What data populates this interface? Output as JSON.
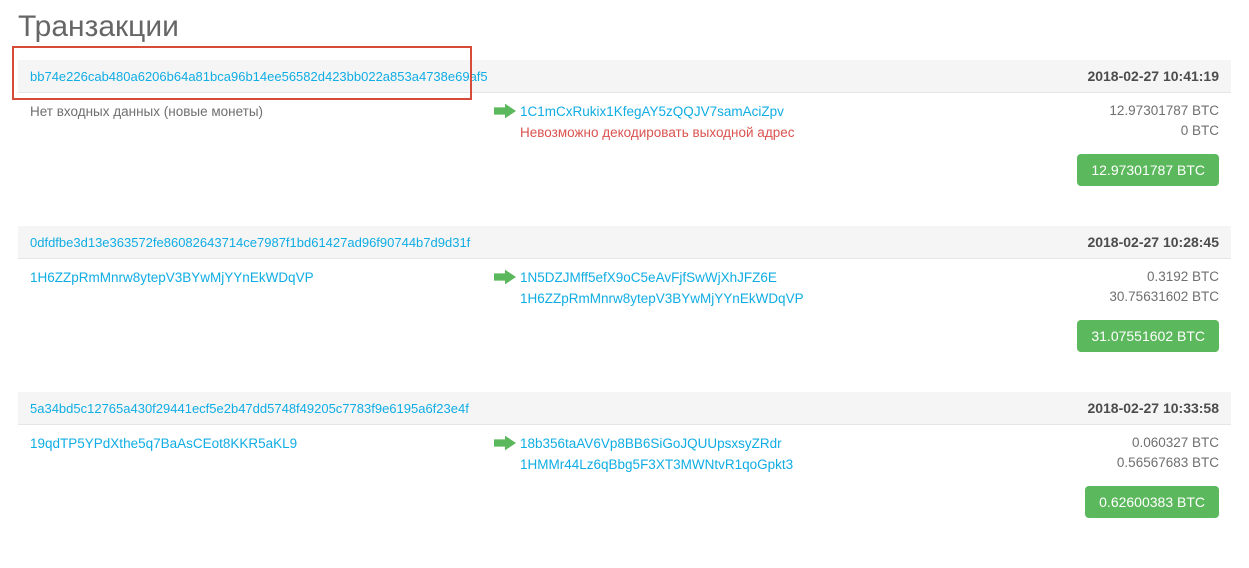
{
  "page_title": "Транзакции",
  "transactions": [
    {
      "hash": "bb74e226cab480a6206b64a81bca96b14ee56582d423bb022a853a4738e69af5",
      "timestamp": "2018-02-27 10:41:19",
      "highlighted": true,
      "inputs": [
        {
          "text": "Нет входных данных (новые монеты)",
          "type": "static"
        }
      ],
      "outputs": [
        {
          "addr": "1C1mCxRukix1KfegAY5zQQJV7samAciZpv",
          "type": "link",
          "amount": "12.97301787 BTC"
        },
        {
          "addr": "Невозможно декодировать выходной адрес",
          "type": "error",
          "amount": "0 BTC"
        }
      ],
      "total": "12.97301787 BTC"
    },
    {
      "hash": "0dfdfbe3d13e363572fe86082643714ce7987f1bd61427ad96f90744b7d9d31f",
      "timestamp": "2018-02-27 10:28:45",
      "inputs": [
        {
          "text": "1H6ZZpRmMnrw8ytepV3BYwMjYYnEkWDqVP",
          "type": "link"
        }
      ],
      "outputs": [
        {
          "addr": "1N5DZJMff5efX9oC5eAvFjfSwWjXhJFZ6E",
          "type": "link",
          "amount": "0.3192 BTC"
        },
        {
          "addr": "1H6ZZpRmMnrw8ytepV3BYwMjYYnEkWDqVP",
          "type": "link",
          "amount": "30.75631602 BTC"
        }
      ],
      "total": "31.07551602 BTC"
    },
    {
      "hash": "5a34bd5c12765a430f29441ecf5e2b47dd5748f49205c7783f9e6195a6f23e4f",
      "timestamp": "2018-02-27 10:33:58",
      "inputs": [
        {
          "text": "19qdTP5YPdXthe5q7BaAsCEot8KKR5aKL9",
          "type": "link"
        }
      ],
      "outputs": [
        {
          "addr": "18b356taAV6Vp8BB6SiGoJQUUpsxsyZRdr",
          "type": "link",
          "amount": "0.060327 BTC"
        },
        {
          "addr": "1HMMr44Lz6qBbg5F3XT3MWNtvR1qoGpkt3",
          "type": "link",
          "amount": "0.56567683 BTC"
        }
      ],
      "total": "0.62600383 BTC"
    }
  ]
}
